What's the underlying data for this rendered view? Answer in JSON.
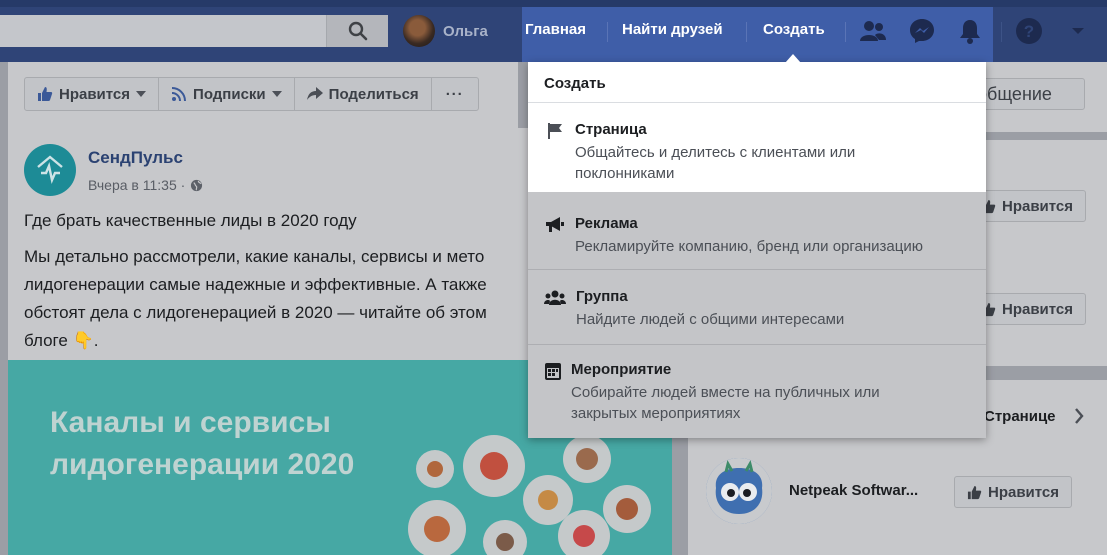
{
  "topbar": {
    "search_placeholder": "",
    "profile_name": "Ольга",
    "nav": {
      "home": "Главная",
      "find_friends": "Найти друзей",
      "create": "Создать"
    }
  },
  "actions": {
    "like": "Нравится",
    "follow": "Подписки",
    "share": "Поделиться",
    "more": "···"
  },
  "post": {
    "author": "СендПульс",
    "time": "Вчера в 11:35 ·",
    "headline": "Где брать качественные лиды в 2020 году",
    "body_lines": [
      "Мы детально рассмотрели, какие каналы, сервисы и мето",
      "лидогенерации самые надежные и эффективные. А также",
      "обстоят дела с лидогенерацией в 2020 — читайте об этом",
      "блоге 👇."
    ],
    "image_title_1": "Каналы и сервисы",
    "image_title_2": "лидогенерации 2020"
  },
  "right_column": {
    "message_btn": "общение",
    "like_btn_1": "Нравится",
    "like_btn_2": "Нравится",
    "pages_label": "Странице",
    "page_name": "Netpeak Softwar...",
    "like_btn_3": "Нравится"
  },
  "dropdown": {
    "header": "Создать",
    "items": [
      {
        "title": "Страница",
        "desc": "Общайтесь и делитесь с клиентами или поклонниками",
        "icon": "flag-icon"
      },
      {
        "title": "Реклама",
        "desc": "Рекламируйте компанию, бренд или организацию",
        "icon": "megaphone-icon"
      },
      {
        "title": "Группа",
        "desc": "Найдите людей с общими интересами",
        "icon": "group-icon"
      },
      {
        "title": "Мероприятие",
        "desc": "Собирайте людей вместе на публичных или закрытых мероприятиях",
        "icon": "calendar-icon"
      }
    ]
  },
  "colors": {
    "nav_bg": "#2f4477",
    "nav_highlight": "#3f5ea8",
    "link_blue": "#2b4272",
    "image_teal": "#46a8a4"
  }
}
